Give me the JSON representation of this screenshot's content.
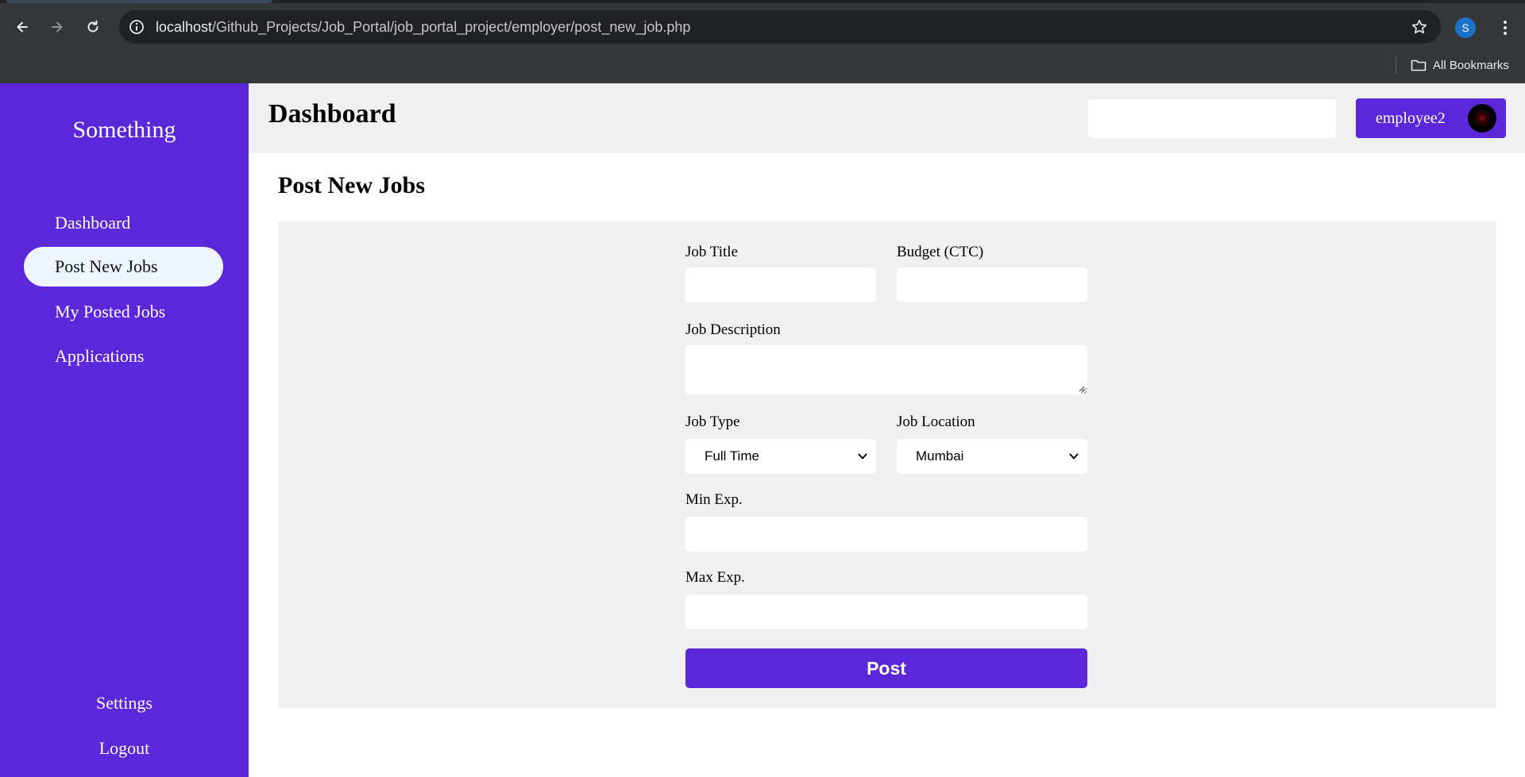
{
  "browser": {
    "url_host": "localhost",
    "url_path": "/Github_Projects/Job_Portal/job_portal_project/employer/post_new_job.php",
    "profile_initial": "S",
    "bookmarks_label": "All Bookmarks"
  },
  "sidebar": {
    "brand": "Something",
    "items": [
      {
        "label": "Dashboard"
      },
      {
        "label": "Post New Jobs"
      },
      {
        "label": "My Posted Jobs"
      },
      {
        "label": "Applications"
      }
    ],
    "bottom": [
      {
        "label": "Settings"
      },
      {
        "label": "Logout"
      }
    ]
  },
  "header": {
    "title": "Dashboard",
    "search_value": "",
    "user_name": "employee2"
  },
  "main": {
    "section_title": "Post New Jobs",
    "form": {
      "job_title_label": "Job Title",
      "job_title_value": "",
      "budget_label": "Budget (CTC)",
      "budget_value": "",
      "description_label": "Job Description",
      "description_value": "",
      "job_type_label": "Job Type",
      "job_type_selected": "Full Time",
      "job_location_label": "Job Location",
      "job_location_selected": "Mumbai",
      "min_exp_label": "Min Exp.",
      "min_exp_value": "",
      "max_exp_label": "Max Exp.",
      "max_exp_value": "",
      "submit_label": "Post"
    }
  },
  "colors": {
    "brand_purple": "#5b27d9",
    "panel_gray": "#f0f0f0",
    "active_item_bg": "#eef4fc"
  }
}
